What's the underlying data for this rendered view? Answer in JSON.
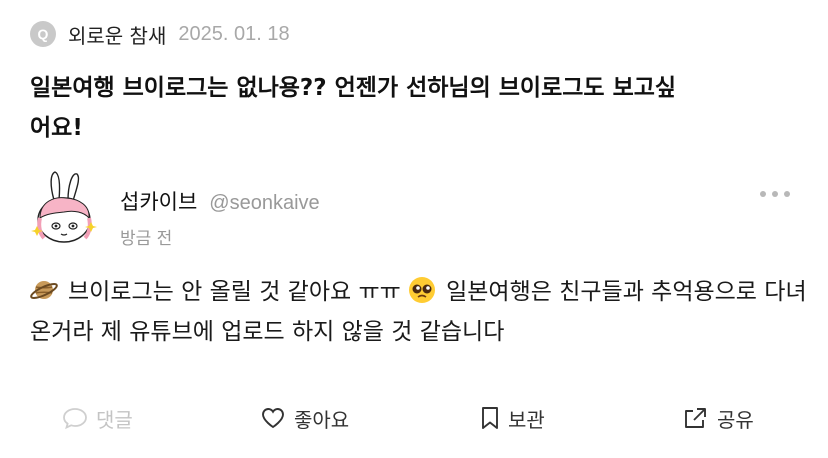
{
  "question": {
    "badge": "Q",
    "author": "외로운 참새",
    "date": "2025. 01. 18",
    "text": "일본여행 브이로그는 없나용?? 언젠가 선하님의 브이로그도 보고싶\n어요!"
  },
  "answer": {
    "author_name": "섭카이브",
    "author_handle": "@seonkaive",
    "time": "방금 전",
    "emoji_1": "saturn-planet-emoji",
    "segment_1": "브이로그는 안 올릴 것 같아요 ㅠㅠ",
    "emoji_2": "pleading-face-emoji",
    "segment_2": "일본여행은 친구들과 추억용으로 다녀온거라 제 유튜브에 업로드 하지 않을 것 같습니다"
  },
  "actions": {
    "comment": "댓글",
    "like": "좋아요",
    "save": "보관",
    "share": "공유"
  },
  "colors": {
    "muted": "#a8a8a8",
    "disabled": "#c4c4c4",
    "text": "#111111"
  }
}
